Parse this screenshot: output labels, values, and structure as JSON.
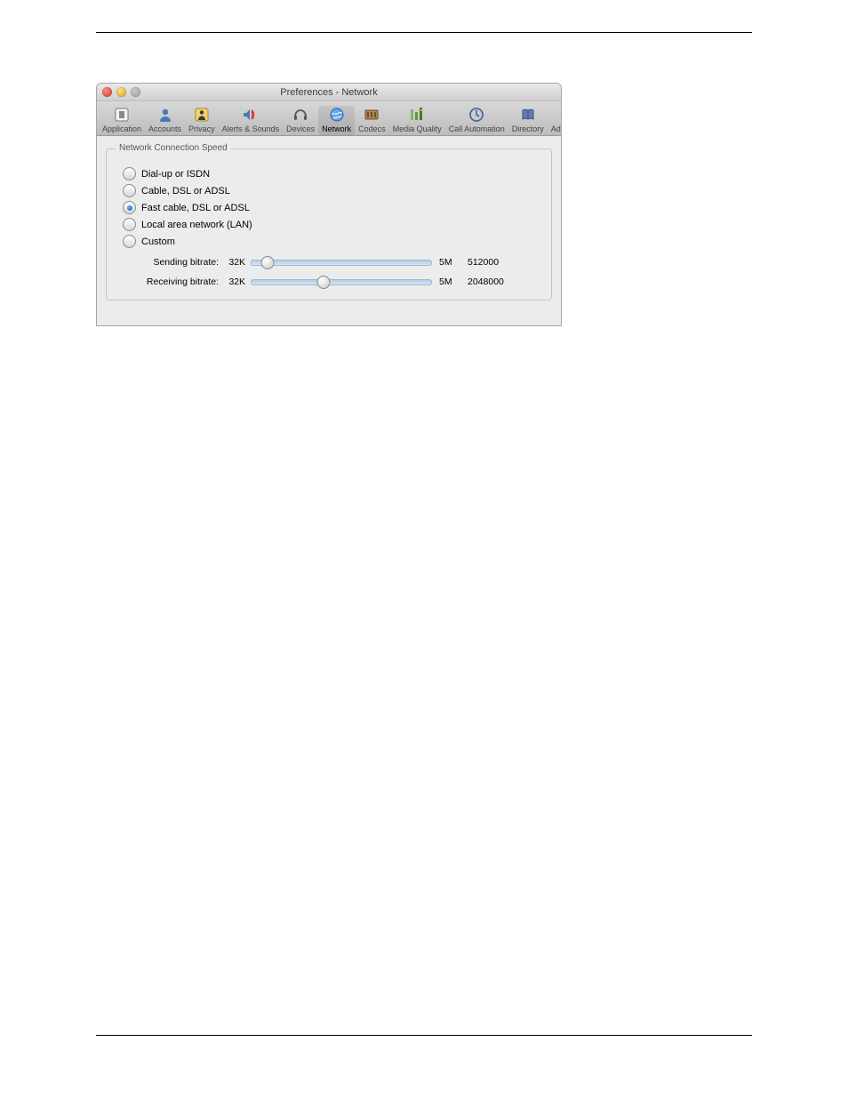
{
  "titlebar": {
    "title": "Preferences - Network"
  },
  "toolbar": {
    "items": [
      {
        "label": "Application"
      },
      {
        "label": "Accounts"
      },
      {
        "label": "Privacy"
      },
      {
        "label": "Alerts & Sounds"
      },
      {
        "label": "Devices"
      },
      {
        "label": "Network"
      },
      {
        "label": "Codecs"
      },
      {
        "label": "Media Quality"
      },
      {
        "label": "Call Automation"
      },
      {
        "label": "Directory"
      },
      {
        "label": "Advanced"
      }
    ],
    "selected_index": 5
  },
  "group": {
    "title": "Network Connection Speed",
    "options": [
      "Dial-up or ISDN",
      "Cable, DSL or ADSL",
      "Fast cable, DSL or ADSL",
      "Local area network (LAN)",
      "Custom"
    ],
    "selected_index": 2,
    "sliders": {
      "send": {
        "label": "Sending bitrate:",
        "min": "32K",
        "max": "5M",
        "value": "512000",
        "pos_pct": 9
      },
      "recv": {
        "label": "Receiving bitrate:",
        "min": "32K",
        "max": "5M",
        "value": "2048000",
        "pos_pct": 40
      }
    }
  }
}
